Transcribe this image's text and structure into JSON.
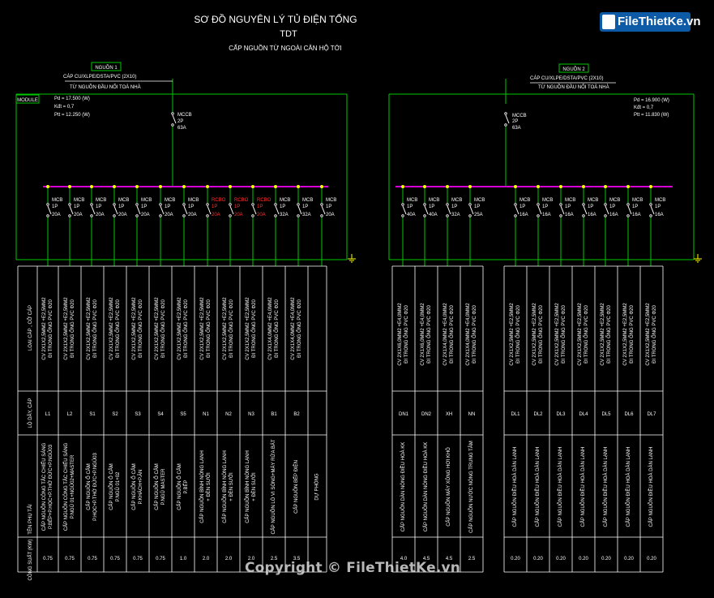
{
  "title": {
    "line1": "SƠ ĐỒ NGUYÊN LÝ TỦ ĐIỆN TỔNG",
    "line2": "TDT",
    "line3": "CẤP NGUỒN TỪ NGOÀI CĂN HỘ TỚI"
  },
  "watermark": {
    "text": "FileThietKe.vn",
    "copyright": "Copyright © FileThietKe.vn"
  },
  "colors": {
    "wire": "#00c800",
    "busbar": "#d400d4",
    "node": "#ffff00",
    "text": "#ffffff",
    "rcbo": "#ff3030",
    "tie": "#00ffff"
  },
  "panel1": {
    "source": "NGUỒN 1",
    "cable": "CÁP CU/XLPE/DSTA/PVC (2X10)",
    "from": "TỪ NGUỒN ĐẦU NỐI TOÀ NHÀ",
    "module": "MODULE",
    "pd": "Pd = 17.500 (W)",
    "kdt": "Kđt = 0,7",
    "ptt": "Ptt = 12.250 (W)",
    "main": {
      "l1": "MCCB",
      "l2": "2P",
      "l3": "63A"
    }
  },
  "panel2": {
    "source": "NGUỒN 2",
    "cable": "CÁP CU/XLPE/DSTA/PVC (2X10)",
    "from": "TỪ NGUỒN ĐẦU NỐI TOÀ NHÀ",
    "pd": "Pd = 16.900 (W)",
    "kdt": "Kđt = 0,7",
    "ptt": "Ptt = 11.830 (W)",
    "main": {
      "l1": "MCCB",
      "l2": "2P",
      "l3": "63A"
    }
  },
  "row_headers": {
    "cable": "LOẠI CÁP , CỠ CÁP",
    "circuit": "LỘ DÂY, CÁP",
    "load": "TÊN PHỤ TẢI",
    "power": "CÔNG SUẤT (KW)"
  },
  "circuits": [
    {
      "type": "MCB",
      "pole": "1P",
      "amp": "20A",
      "cable1": "CV 2X1X2,5MM2 +E2,5MM2",
      "cable2": "ĐI TRONG ỐNG PVC Φ20",
      "id": "L1",
      "load1": "CẤP NGUỒN CÔNG TẮC CHIẾU SÁNG",
      "load2": "P.BẾP+P.HỌC+P.THỜ ĐỨC+P.NGỦ03",
      "power": "0.75"
    },
    {
      "type": "MCB",
      "pole": "1P",
      "amp": "20A",
      "cable1": "CV 2X1X2,5MM2 +E2,5MM2",
      "cable2": "ĐI TRONG ỐNG PVC Φ20",
      "id": "L2",
      "load1": "CẤP NGUỒN CÔNG TẮC CHIẾU SÁNG",
      "load2": "P.NGỦ 01+NGỦ02+MASTER",
      "power": "0.75"
    },
    {
      "type": "MCB",
      "pole": "1P",
      "amp": "20A",
      "cable1": "CV 2X1X2,5MM2 +E2,5MM2",
      "cable2": "ĐI TRONG ỐNG PVC Φ20",
      "id": "S1",
      "load1": "CẤP NGUỒN Ổ CẮM",
      "load2": "P.HỌC+P.THỜ ĐỨC+P.NGỦ03",
      "power": "0.75"
    },
    {
      "type": "MCB",
      "pole": "1P",
      "amp": "20A",
      "cable1": "CV 2X1X2,5MM2 +E2,5MM2",
      "cable2": "ĐI TRONG ỐNG PVC Φ20",
      "id": "S2",
      "load1": "CẤP NGUỒN Ổ CẮM",
      "load2": "P.NGỦ 01+02",
      "power": "0.75"
    },
    {
      "type": "MCB",
      "pole": "1P",
      "amp": "20A",
      "cable1": "CV 2X1X2,5MM2 +E2,5MM2",
      "cable2": "ĐI TRONG ỐNG PVC Φ20",
      "id": "S3",
      "load1": "CẤP NGUỒN Ổ CẮM",
      "load2": "P.KHÁCH+P.ĂN",
      "power": "0.75"
    },
    {
      "type": "MCB",
      "pole": "1P",
      "amp": "20A",
      "cable1": "CV 2X1X2,5MM2 +E2,5MM2",
      "cable2": "ĐI TRONG ỐNG PVC Φ20",
      "id": "S4",
      "load1": "CẤP NGUỒN Ổ CẮM",
      "load2": "P.NGỦ MASTER",
      "power": "0.75"
    },
    {
      "type": "MCB",
      "pole": "1P",
      "amp": "20A",
      "cable1": "CV 2X1X2,5MM2 +E2,5MM2",
      "cable2": "ĐI TRONG ỐNG PVC Φ20",
      "id": "S5",
      "load1": "CẤP NGUỒN Ổ CẮM",
      "load2": "P.BẾP",
      "power": "1.0"
    },
    {
      "type": "RCBO",
      "pole": "1P",
      "amp": "20A",
      "cable1": "CV 2X1X2,5MM2 +E2,5MM2",
      "cable2": "ĐI TRONG ỐNG PVC Φ20",
      "id": "N1",
      "load1": "CẤP NGUỒN BÌNH NÓNG LẠNH",
      "load2": "+ ĐÈN SƯỞI",
      "power": "2.0"
    },
    {
      "type": "RCBO",
      "pole": "1P",
      "amp": "20A",
      "cable1": "CV 2X1X2,5MM2 +E2,5MM2",
      "cable2": "ĐI TRONG ỐNG PVC Φ20",
      "id": "N2",
      "load1": "CẤP NGUỒN BÌNH NÓNG LẠNH",
      "load2": "+ ĐÈN SƯỞI",
      "power": "2.0"
    },
    {
      "type": "RCBO",
      "pole": "1P",
      "amp": "20A",
      "cable1": "CV 2X1X2,5MM2 +E2,5MM2",
      "cable2": "ĐI TRONG ỐNG PVC Φ20",
      "id": "N3",
      "load1": "CẤP NGUỒN BÌNH NÓNG LẠNH",
      "load2": "+ ĐÈN SƯỞI",
      "power": "2.0"
    },
    {
      "type": "MCB",
      "pole": "1P",
      "amp": "32A",
      "cable1": "CV 2X1X4,0MM2 +E4,0MM2",
      "cable2": "ĐI TRONG ỐNG PVC Φ20",
      "id": "B1",
      "load1": "CẤP NGUỒN LÒ VI SÓNG+MÁY RỬA BÁT",
      "load2": "",
      "power": "2.5"
    },
    {
      "type": "MCB",
      "pole": "1P",
      "amp": "32A",
      "cable1": "CV 2X1X4,0MM2 +E4,0MM2",
      "cable2": "ĐI TRONG ỐNG PVC Φ20",
      "id": "B2",
      "load1": "CẤP NGUỒN BẾP ĐIỆN",
      "load2": "",
      "power": "3.5"
    },
    {
      "type": "MCB",
      "pole": "1P",
      "amp": "20A",
      "cable1": "",
      "cable2": "",
      "id": "",
      "load1": "DỰ PHÒNG",
      "load2": "",
      "power": ""
    }
  ],
  "circuits2a": [
    {
      "type": "MCB",
      "pole": "1P",
      "amp": "40A",
      "cable1": "CV 2X1X6,0MM2 +E4,0MM2",
      "cable2": "ĐI TRONG ỐNG PVC Φ20",
      "id": "DN1",
      "load1": "CẤP NGUỒN DÀN NÓNG ĐIỀU HOÀ KK",
      "power": "4.0"
    },
    {
      "type": "MCB",
      "pole": "1P",
      "amp": "40A",
      "cable1": "CV 2X1X6,0MM2 +E4,0MM2",
      "cable2": "ĐI TRONG ỐNG PVC Φ20",
      "id": "DN2",
      "load1": "CẤP NGUỒN DÀN NÓNG ĐIỀU HOÀ KK",
      "power": "4.5"
    },
    {
      "type": "MCB",
      "pole": "1P",
      "amp": "32A",
      "cable1": "CV 2X1X4,0MM2 +E4,0MM2",
      "cable2": "ĐI TRONG ỐNG PVC Φ20",
      "id": "XH",
      "load1": "CẤP NGUỒN MÁY XÔNG HƠI KHÔ",
      "power": "4.5"
    },
    {
      "type": "MCB",
      "pole": "1P",
      "amp": "25A",
      "cable1": "CV 2X1X4,0MM2 +E4,0MM2",
      "cable2": "ĐI TRONG ỐNG PVC Φ20",
      "id": "NN",
      "load1": "CẤP NGUỒN NƯỚC NÓNG TRUNG TÂM",
      "power": "2.5"
    }
  ],
  "circuits2b": [
    {
      "type": "MCB",
      "pole": "1P",
      "amp": "16A",
      "cable1": "CV 2X1X2,5MM2 +E2,5MM2",
      "cable2": "ĐI TRONG ỐNG PVC Φ20",
      "id": "DL1",
      "load1": "CẤP NGUỒN ĐIỀU HOÀ DÀN LẠNH",
      "power": "0.20"
    },
    {
      "type": "MCB",
      "pole": "1P",
      "amp": "16A",
      "cable1": "CV 2X1X2,5MM2 +E2,5MM2",
      "cable2": "ĐI TRONG ỐNG PVC Φ20",
      "id": "DL2",
      "load1": "CẤP NGUỒN ĐIỀU HOÀ DÀN LẠNH",
      "power": "0.20"
    },
    {
      "type": "MCB",
      "pole": "1P",
      "amp": "16A",
      "cable1": "CV 2X1X2,5MM2 +E2,5MM2",
      "cable2": "ĐI TRONG ỐNG PVC Φ20",
      "id": "DL3",
      "load1": "CẤP NGUỒN ĐIỀU HOÀ DÀN LẠNH",
      "power": "0.20"
    },
    {
      "type": "MCB",
      "pole": "1P",
      "amp": "16A",
      "cable1": "CV 2X1X2,5MM2 +E2,5MM2",
      "cable2": "ĐI TRONG ỐNG PVC Φ20",
      "id": "DL4",
      "load1": "CẤP NGUỒN ĐIỀU HOÀ DÀN LẠNH",
      "power": "0.20"
    },
    {
      "type": "MCB",
      "pole": "1P",
      "amp": "16A",
      "cable1": "CV 2X1X2,5MM2 +E2,5MM2",
      "cable2": "ĐI TRONG ỐNG PVC Φ20",
      "id": "DL5",
      "load1": "CẤP NGUỒN ĐIỀU HOÀ DÀN LẠNH",
      "power": "0.20"
    },
    {
      "type": "MCB",
      "pole": "1P",
      "amp": "16A",
      "cable1": "CV 2X1X2,5MM2 +E2,5MM2",
      "cable2": "ĐI TRONG ỐNG PVC Φ20",
      "id": "DL6",
      "load1": "CẤP NGUỒN ĐIỀU HOÀ DÀN LẠNH",
      "power": "0.20"
    },
    {
      "type": "MCB",
      "pole": "1P",
      "amp": "16A",
      "cable1": "CV 2X1X2,5MM2 +E2,5MM2",
      "cable2": "ĐI TRONG ỐNG PVC Φ20",
      "id": "DL7",
      "load1": "CẤP NGUỒN ĐIỀU HOÀ DÀN LẠNH",
      "power": "0.20"
    }
  ]
}
